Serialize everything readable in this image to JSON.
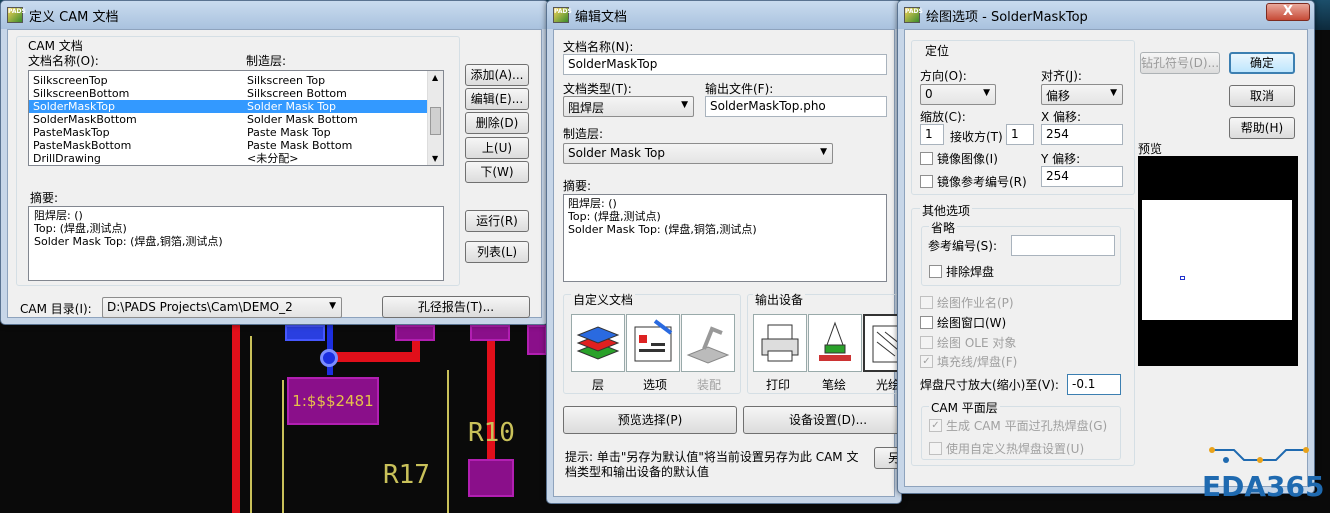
{
  "cam_window": {
    "title": "定义 CAM 文档",
    "group_label": "CAM 文档",
    "col_name": "文档名称(O):",
    "col_layer": "制造层:",
    "rows": [
      {
        "name": "SilkscreenTop",
        "layer": "Silkscreen Top"
      },
      {
        "name": "SilkscreenBottom",
        "layer": "Silkscreen Bottom"
      },
      {
        "name": "SolderMaskTop",
        "layer": "Solder Mask Top"
      },
      {
        "name": "SolderMaskBottom",
        "layer": "Solder Mask Bottom"
      },
      {
        "name": "PasteMaskTop",
        "layer": "Paste Mask Top"
      },
      {
        "name": "PasteMaskBottom",
        "layer": "Paste Mask Bottom"
      },
      {
        "name": "DrillDrawing",
        "layer": "<未分配>"
      }
    ],
    "buttons": {
      "add": "添加(A)...",
      "edit": "编辑(E)...",
      "delete": "删除(D)",
      "up": "上(U)",
      "down": "下(W)",
      "run": "运行(R)",
      "table": "列表(L)",
      "drill_report": "孔径报告(T)..."
    },
    "summary_label": "摘要:",
    "summary": [
      "阻焊层: ()",
      "Top: (焊盘,测试点)",
      "Solder Mask Top: (焊盘,铜箔,测试点)"
    ],
    "dir_label": "CAM 目录(I):",
    "dir_value": "D:\\PADS Projects\\Cam\\DEMO_2"
  },
  "edit_window": {
    "title": "编辑文档",
    "doc_name_label": "文档名称(N):",
    "doc_name": "SolderMaskTop",
    "doc_type_label": "文档类型(T):",
    "doc_type": "阻焊层",
    "output_label": "输出文件(F):",
    "output_file": "SolderMaskTop.pho",
    "layer_label": "制造层:",
    "layer": "Solder Mask Top",
    "summary_label": "摘要:",
    "summary": [
      "阻焊层: ()",
      "Top: (焊盘,测试点)",
      "Solder Mask Top: (焊盘,铜箔,测试点)"
    ],
    "custom_label": "自定义文档",
    "custom_items": [
      "层",
      "选项",
      "装配"
    ],
    "device_label": "输出设备",
    "device_items": [
      "打印",
      "笔绘",
      "光绘"
    ],
    "preview_btn": "预览选择(P)",
    "device_btn": "设备设置(D)...",
    "hint": "提示: 单击\"另存为默认值\"将当前设置另存为此 CAM 文档类型和输出设备的默认值",
    "saveas_btn": "另"
  },
  "plot_window": {
    "title": "绘图选项 - SolderMaskTop",
    "close": "X",
    "position_label": "定位",
    "orientation_label": "方向(O):",
    "orientation": "0",
    "justify_label": "对齐(J):",
    "justify": "偏移",
    "scale_label": "缩放(C):",
    "scale": "1",
    "fit_label": "接收方(T)",
    "fit": "1",
    "x_offset_label": "X 偏移:",
    "x_offset": "254",
    "y_offset_label": "Y 偏移:",
    "y_offset": "254",
    "mirror_image": "镜像图像(I)",
    "mirror_ref": "镜像参考编号(R)",
    "drill_btn": "钻孔符号(D)...",
    "ok_btn": "确定",
    "cancel_btn": "取消",
    "help_btn": "帮助(H)",
    "preview_label": "预览",
    "other_label": "其他选项",
    "omit_label": "省略",
    "refdes_label": "参考编号(S):",
    "refdes_value": "",
    "exclude_pads": "排除焊盘",
    "plot_job": "绘图作业名(P)",
    "plot_window": "绘图窗口(W)",
    "plot_ole": "绘图 OLE 对象",
    "fill_pads": "填充线/焊盘(F)",
    "pad_size_label": "焊盘尺寸放大(缩小)至(V):",
    "pad_size": "-0.1",
    "cam_plane_label": "CAM 平面层",
    "gen_thermal": "生成 CAM 平面过孔热焊盘(G)",
    "custom_thermal": "使用自定义热焊盘设置(U)"
  },
  "pcb": {
    "pad_label": "1:$$$2481",
    "ref_r10": "R10",
    "ref_r17": "R17"
  },
  "watermark": "EDA365"
}
